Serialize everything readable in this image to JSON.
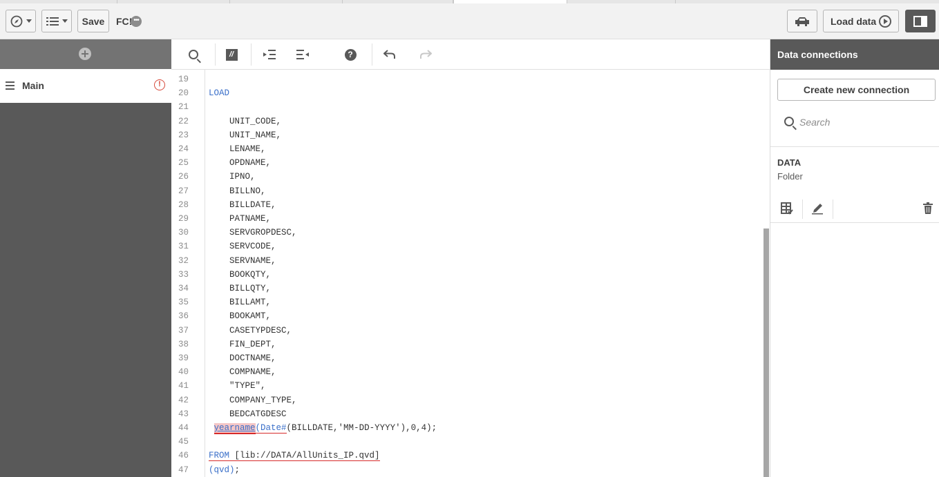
{
  "toolbar": {
    "save_label": "Save",
    "app_name": "FC!",
    "app_menu_glyph": "•••",
    "load_data_label": "Load data",
    "icons": [
      "compass-icon",
      "list-icon",
      "debug-icon",
      "load-run-icon",
      "panel-toggle-icon"
    ]
  },
  "sidebar": {
    "add_icon": "plus-circle-icon",
    "sections": [
      {
        "label": "Main",
        "status": "error"
      }
    ]
  },
  "editor": {
    "tools": [
      "search-icon",
      "comment-icon",
      "indent-icon",
      "outdent-icon",
      "help-icon",
      "undo-icon",
      "redo-icon"
    ],
    "help_glyph": "?",
    "comment_glyph": "//",
    "lines": [
      {
        "num": "19",
        "text": ""
      },
      {
        "num": "20",
        "text": "LOAD"
      },
      {
        "num": "21",
        "text": ""
      },
      {
        "num": "22",
        "text": "    UNIT_CODE,"
      },
      {
        "num": "23",
        "text": "    UNIT_NAME,"
      },
      {
        "num": "24",
        "text": "    LENAME,"
      },
      {
        "num": "25",
        "text": "    OPDNAME,"
      },
      {
        "num": "26",
        "text": "    IPNO,"
      },
      {
        "num": "27",
        "text": "    BILLNO,"
      },
      {
        "num": "28",
        "text": "    BILLDATE,"
      },
      {
        "num": "29",
        "text": "    PATNAME,"
      },
      {
        "num": "30",
        "text": "    SERVGROPDESC,"
      },
      {
        "num": "31",
        "text": "    SERVCODE,"
      },
      {
        "num": "32",
        "text": "    SERVNAME,"
      },
      {
        "num": "33",
        "text": "    BOOKQTY,"
      },
      {
        "num": "34",
        "text": "    BILLQTY,"
      },
      {
        "num": "35",
        "text": "    BILLAMT,"
      },
      {
        "num": "36",
        "text": "    BOOKAMT,"
      },
      {
        "num": "37",
        "text": "    CASETYPDESC,"
      },
      {
        "num": "38",
        "text": "    FIN_DEPT,"
      },
      {
        "num": "39",
        "text": "    DOCTNAME,"
      },
      {
        "num": "40",
        "text": "    COMPNAME,"
      },
      {
        "num": "41",
        "text": "    \"TYPE\","
      },
      {
        "num": "42",
        "text": "    COMPANY_TYPE,"
      },
      {
        "num": "43",
        "text": "    BEDCATGDESC"
      },
      {
        "num": "44",
        "text": " yearname(Date#(BILLDATE,'MM-DD-YYYY'),0,4);"
      },
      {
        "num": "45",
        "text": ""
      },
      {
        "num": "46",
        "text": "FROM [lib://DATA/AllUnits_IP.qvd]"
      },
      {
        "num": "47",
        "text": "(qvd);"
      }
    ],
    "line44_parts": {
      "indent": " ",
      "err": "yearname",
      "fn": "(Date#",
      "rest": "(BILLDATE,'MM-DD-YYYY'),0,4);"
    },
    "line46_parts": {
      "kw": "FROM",
      "rest": " [lib://DATA/AllUnits_IP.qvd]"
    },
    "line47_parts": {
      "kw": "(qvd)",
      "rest": ";"
    }
  },
  "data_connections": {
    "title": "Data connections",
    "create_label": "Create new connection",
    "search_placeholder": "Search",
    "items": [
      {
        "name": "DATA",
        "type": "Folder"
      }
    ],
    "item_actions": [
      "select-data-icon",
      "edit-icon",
      "delete-icon"
    ]
  },
  "colors": {
    "keyword": "#3a6fc9",
    "error": "#d62a2a",
    "panel_dark": "#595959"
  }
}
